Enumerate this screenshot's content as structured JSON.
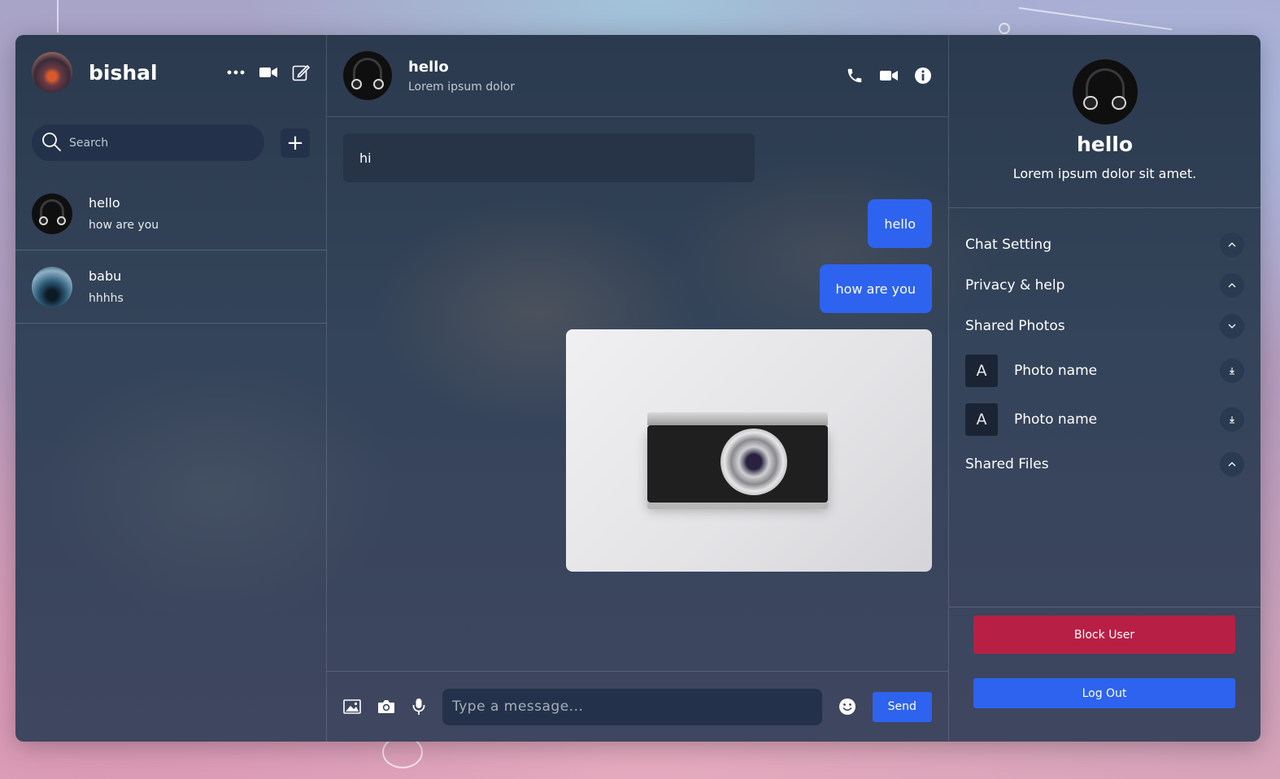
{
  "sidebar": {
    "user_name": "bishal",
    "search_placeholder": "Search",
    "add_label": "+",
    "chats": [
      {
        "name": "hello",
        "last_message": "how are you",
        "avatar": "headphones"
      },
      {
        "name": "babu",
        "last_message": "hhhhs",
        "avatar": "night"
      }
    ]
  },
  "chat": {
    "name": "hello",
    "status": "Lorem ipsum dolor",
    "messages": [
      {
        "direction": "in",
        "text": "hi"
      },
      {
        "direction": "out",
        "text": "hello"
      },
      {
        "direction": "out",
        "text": "how are you"
      },
      {
        "direction": "out",
        "type": "image",
        "image": "camera-photo"
      }
    ],
    "composer": {
      "placeholder": "Type a message...",
      "send_label": "Send"
    }
  },
  "details": {
    "name": "hello",
    "bio": "Lorem ipsum dolor sit amet.",
    "sections": {
      "chat_setting": "Chat Setting",
      "privacy": "Privacy & help",
      "shared_photos": "Shared Photos",
      "shared_files": "Shared Files"
    },
    "photos": [
      {
        "thumb": "A",
        "name": "Photo name"
      },
      {
        "thumb": "A",
        "name": "Photo name"
      }
    ],
    "block_label": "Block User",
    "logout_label": "Log Out"
  },
  "colors": {
    "accent": "#2d63ee",
    "danger": "#b81f45",
    "panel": "#23324a"
  }
}
